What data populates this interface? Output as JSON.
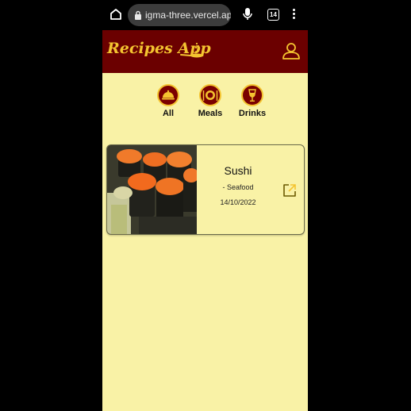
{
  "browser": {
    "url": "igma-three.vercel.app",
    "tab_count": "14"
  },
  "header": {
    "brand": "Recipes App"
  },
  "filters": [
    {
      "label": "All",
      "icon": "all-food-icon"
    },
    {
      "label": "Meals",
      "icon": "plate-cutlery-icon"
    },
    {
      "label": "Drinks",
      "icon": "wine-glass-icon"
    }
  ],
  "recipes": [
    {
      "title": "Sushi",
      "category": "- Seafood",
      "date": "14/10/2022",
      "image": "sushi-photo"
    }
  ],
  "colors": {
    "header_bg": "#6b0000",
    "accent": "#f4c430",
    "page_bg": "#f9f2a6",
    "outside_bg": "#000000"
  }
}
